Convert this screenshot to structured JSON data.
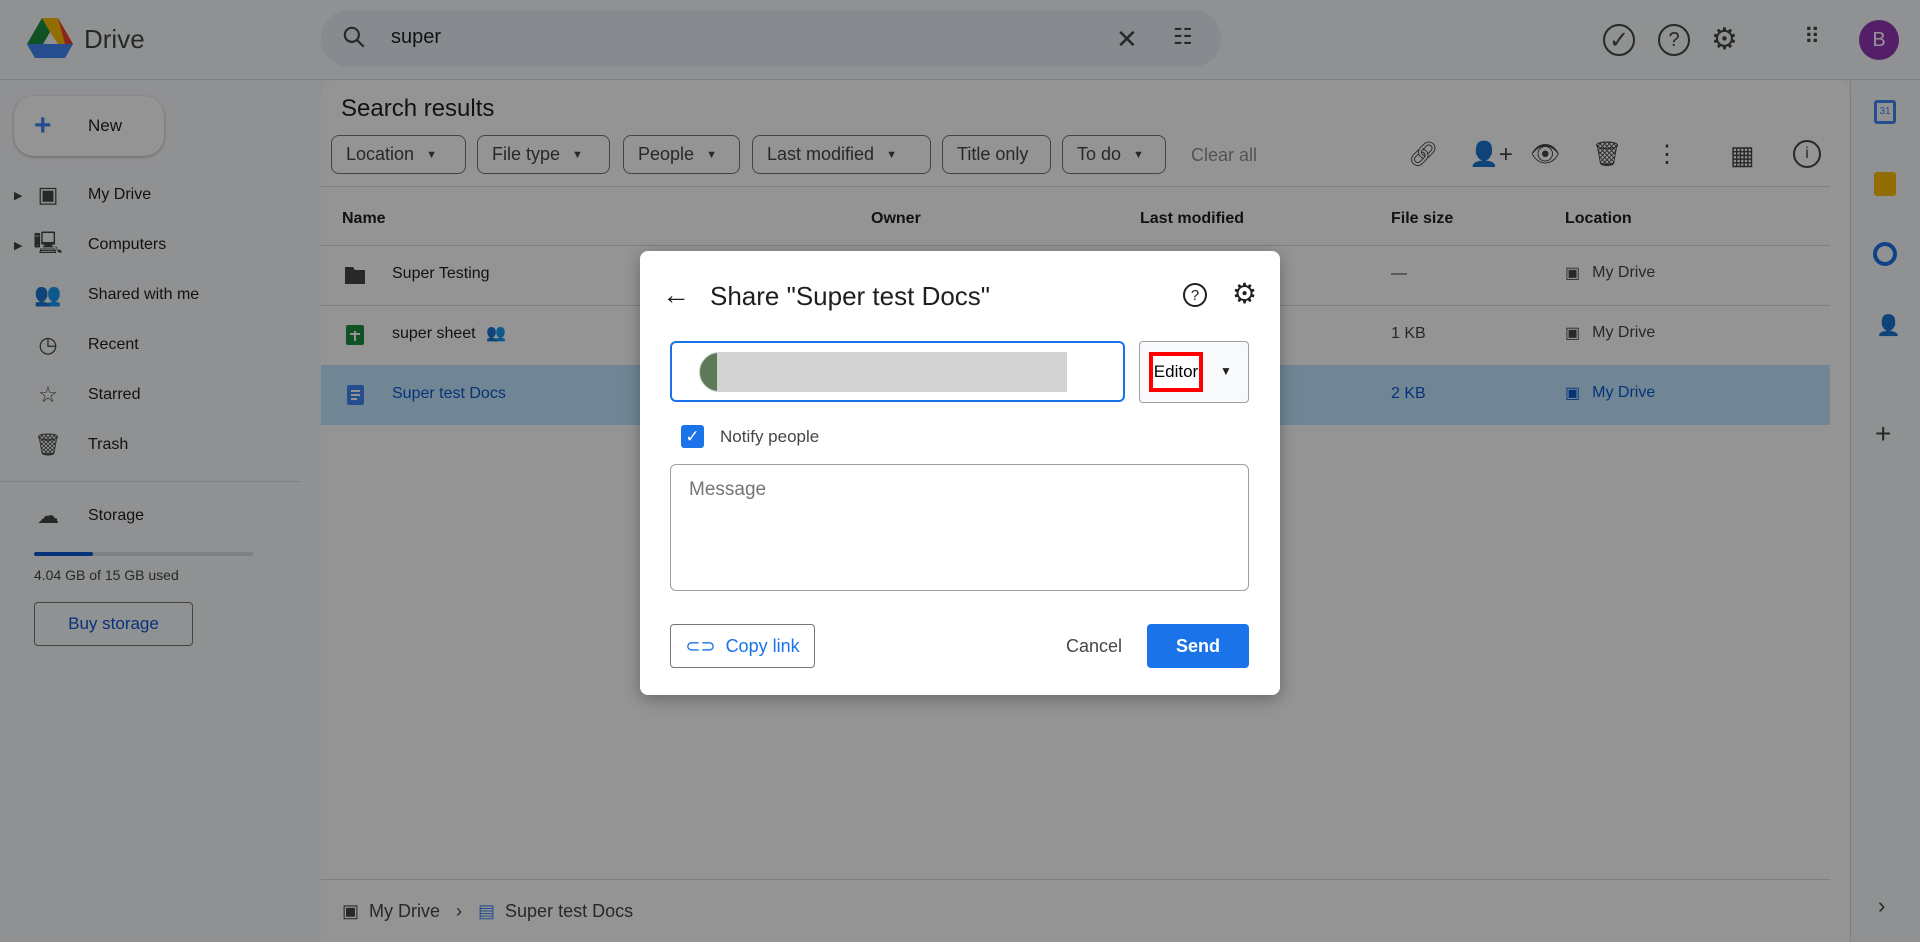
{
  "app": {
    "name": "Drive",
    "avatar_letter": "B",
    "avatar_color": "#9334b4"
  },
  "search": {
    "value": "super"
  },
  "new_button": "New",
  "sidebar": {
    "items": [
      {
        "label": "My Drive",
        "icon": "my-drive-icon"
      },
      {
        "label": "Computers",
        "icon": "computers-icon"
      },
      {
        "label": "Shared with me",
        "icon": "people-icon"
      },
      {
        "label": "Recent",
        "icon": "clock-icon"
      },
      {
        "label": "Starred",
        "icon": "star-icon"
      },
      {
        "label": "Trash",
        "icon": "trash-icon"
      }
    ],
    "storage_label": "Storage",
    "storage_used": "4.04 GB of 15 GB used",
    "storage_fraction": 0.27,
    "buy_storage": "Buy storage"
  },
  "main": {
    "title": "Search results",
    "filters": [
      "Location",
      "File type",
      "People",
      "Last modified",
      "Title only",
      "To do"
    ],
    "clear_all": "Clear all",
    "columns": [
      "Name",
      "Owner",
      "Last modified",
      "File size",
      "Location"
    ],
    "rows": [
      {
        "name": "Super Testing",
        "type": "folder",
        "size": "—",
        "location": "My Drive"
      },
      {
        "name": "super sheet",
        "type": "sheet",
        "shared": true,
        "size": "1 KB",
        "location": "My Drive"
      },
      {
        "name": "Super test Docs",
        "type": "doc",
        "size": "2 KB",
        "location": "My Drive",
        "selected": true
      }
    ],
    "breadcrumb": [
      "My Drive",
      "Super test Docs"
    ]
  },
  "dialog": {
    "title": "Share \"Super test Docs\"",
    "role": "Editor",
    "notify_label": "Notify people",
    "notify_checked": true,
    "message_placeholder": "Message",
    "copy_link": "Copy link",
    "cancel": "Cancel",
    "send": "Send",
    "accent": "#1a73e8",
    "highlight": "#ff0000"
  }
}
